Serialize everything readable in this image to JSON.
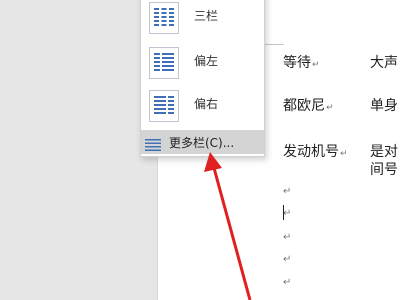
{
  "menu": {
    "items": [
      {
        "label": "三栏",
        "icon": "three-columns-icon"
      },
      {
        "label": "偏左",
        "icon": "left-column-icon"
      },
      {
        "label": "偏右",
        "icon": "right-column-icon"
      }
    ],
    "more": {
      "label": "更多栏(C)...",
      "icon": "more-columns-icon"
    }
  },
  "document": {
    "rows": [
      {
        "col1": "等待",
        "col2": "大声"
      },
      {
        "col1": "都欧尼",
        "col2": "单身"
      },
      {
        "col1": "发动机号",
        "col2": "是对",
        "col2_line2": "间号"
      }
    ],
    "para_mark": "↵"
  },
  "colors": {
    "highlight": "#d4d4d4",
    "arrow": "#e02020",
    "icon_blue": "#3f6fb5"
  }
}
